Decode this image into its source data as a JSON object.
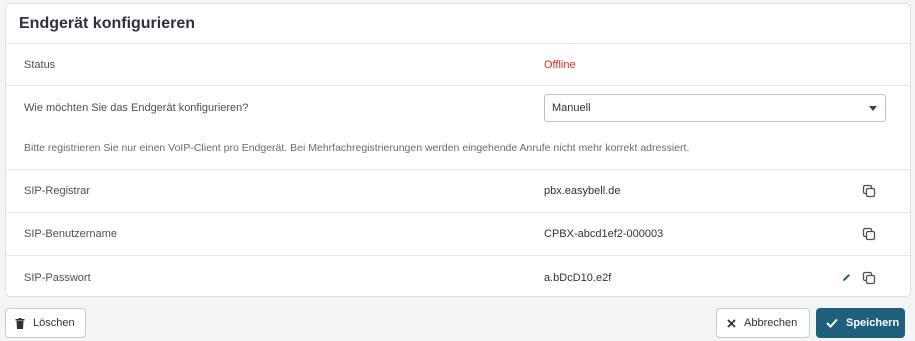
{
  "card": {
    "title": "Endgerät konfigurieren"
  },
  "status": {
    "label": "Status",
    "value": "Offline",
    "value_color": "#e02929"
  },
  "config": {
    "label": "Wie möchten Sie das Endgerät konfigurieren?",
    "selected": "Manuell",
    "hint": "Bitte registrieren Sie nur einen VoIP-Client pro Endgerät. Bei Mehrfachregistrierungen werden eingehende Anrufe nicht mehr korrekt adressiert."
  },
  "sip": {
    "registrar": {
      "label": "SIP-Registrar",
      "value": "pbx.easybell.de",
      "icon": "copy-icon"
    },
    "username": {
      "label": "SIP-Benutzername",
      "value": "CPBX-abcd1ef2-000003",
      "icon": "copy-icon"
    },
    "password": {
      "label": "SIP-Passwort",
      "value": "a.bDcD10.e2f",
      "icons": [
        "pencil-icon",
        "copy-icon"
      ]
    }
  },
  "actions": {
    "delete_label": "Löschen",
    "cancel_label": "Abbrechen",
    "save_label": "Speichern",
    "save_color": "#1e5f7c"
  }
}
